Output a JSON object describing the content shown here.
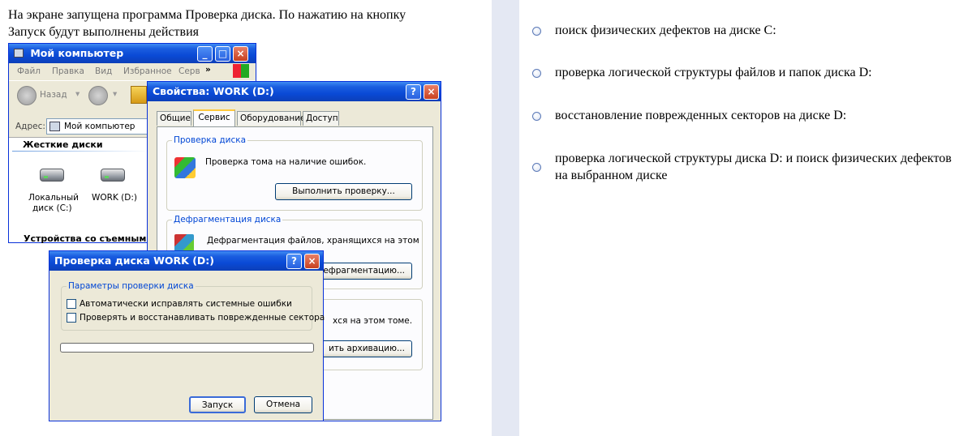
{
  "question": {
    "line1": "На экране запущена программа Проверка диска. По нажатию на кнопку",
    "line2": "Запуск будут выполнены действия"
  },
  "answers": [
    {
      "text": "поиск физических дефектов на диске С:"
    },
    {
      "text": "проверка логической структуры файлов и папок диска D:"
    },
    {
      "text": "восстановление поврежденных секторов на диске D:"
    },
    {
      "text": "проверка логической структуры диска D: и поиск физических дефектов на выбранном диске"
    }
  ],
  "my_computer": {
    "title": "Мой компьютер",
    "menu": [
      "Файл",
      "Правка",
      "Вид",
      "Избранное",
      "Серв"
    ],
    "menu_more": "»",
    "back_label": "Назад",
    "address_label": "Адрес:",
    "address_value": "Мой компьютер",
    "section_title": "Жесткие диски",
    "drives": [
      {
        "line1": "Локальный",
        "line2": "диск (C:)"
      },
      {
        "line1": "WORK (D:)",
        "line2": ""
      }
    ],
    "footer_partial": "Устройства со съемными"
  },
  "properties": {
    "title": "Свойства: WORK (D:)",
    "tabs": [
      "Общие",
      "Сервис",
      "Оборудование",
      "Доступ"
    ],
    "check_group": {
      "label": "Проверка диска",
      "text": "Проверка тома на наличие ошибок.",
      "button": "Выполнить проверку..."
    },
    "defrag_group": {
      "label": "Дефрагментация диска",
      "text": "Дефрагментация файлов, хранящихся на этом",
      "button_partial": "дефрагментацию..."
    },
    "archive_group": {
      "text_partial": "хся на этом томе.",
      "button_partial": "ить архивацию..."
    }
  },
  "check_dialog": {
    "title": "Проверка диска WORK (D:)",
    "group_label": "Параметры проверки диска",
    "options": [
      {
        "label": "Автоматически исправлять системные ошибки",
        "checked": false
      },
      {
        "label": "Проверять и восстанавливать поврежденные сектора",
        "checked": false
      }
    ],
    "progress": 0,
    "start_button": "Запуск",
    "cancel_button": "Отмена"
  },
  "window_buttons": {
    "minimize": "_",
    "maximize": "□",
    "close": "×",
    "help": "?"
  },
  "colors": {
    "xp_title": "#0a4ad6",
    "xp_face": "#ece9d8",
    "group_label": "#0046d5",
    "radio_border": "#5b79b7"
  }
}
